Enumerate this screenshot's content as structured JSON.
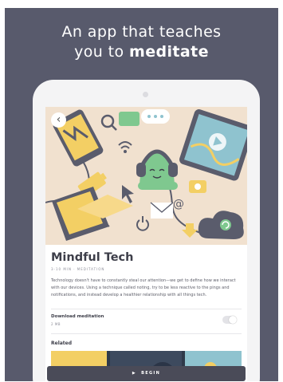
{
  "promo": {
    "headline_line1": "An app that teaches",
    "headline_line2_prefix": "you to ",
    "headline_line2_emphasis": "meditate",
    "background_color": "#585a6c"
  },
  "hero": {
    "back_glyph": "‹",
    "back_icon": "chevron-left-icon"
  },
  "content": {
    "title": "Mindful Tech",
    "meta": "3-10 MIN · MEDITATION",
    "description": "Technology doesn't have to constantly steal our attention—we get to define how we interact with our devices. Using a technique called noting, try to be less reactive to the pings and notifications, and instead develop a healthier relationship with all things tech."
  },
  "download": {
    "label": "Download meditation",
    "size": "2 MB",
    "enabled": false
  },
  "related": {
    "heading": "Related"
  },
  "cta": {
    "begin_label": "BEGIN",
    "begin_glyph": "▶"
  },
  "colors": {
    "accent_green": "#7fc88f",
    "accent_blue": "#8fc3cf",
    "accent_yellow": "#f3cf64",
    "ink": "#3d3e49"
  }
}
